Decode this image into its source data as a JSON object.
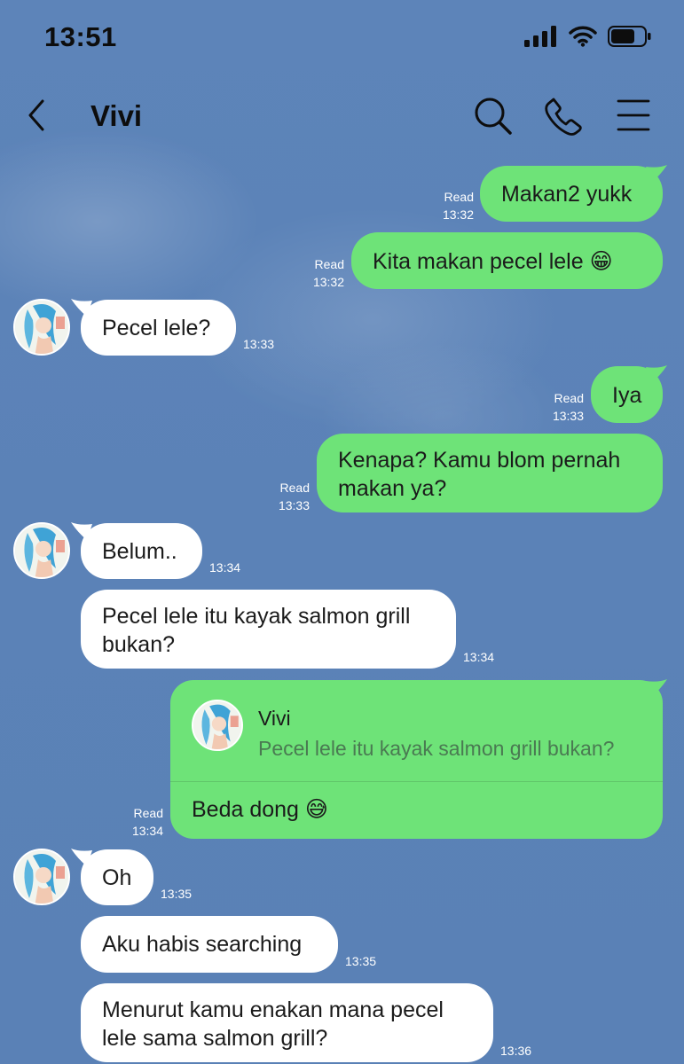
{
  "status_bar": {
    "time": "13:51"
  },
  "header": {
    "title": "Vivi",
    "icons": [
      "back-icon",
      "search-icon",
      "call-icon",
      "menu-icon"
    ]
  },
  "colors": {
    "outgoing": "#6ee378",
    "incoming": "#ffffff",
    "background": "#5a82b8"
  },
  "messages": [
    {
      "dir": "out",
      "text": "Makan2 yukk",
      "status": "Read",
      "time": "13:32"
    },
    {
      "dir": "out",
      "text": "Kita makan pecel lele 😁",
      "status": "Read",
      "time": "13:32"
    },
    {
      "dir": "in",
      "text": "Pecel lele?",
      "time": "13:33"
    },
    {
      "dir": "out",
      "text": "Iya",
      "status": "Read",
      "time": "13:33"
    },
    {
      "dir": "out",
      "lines": [
        "Kenapa? Kamu blom pernah",
        "makan ya?"
      ],
      "status": "Read",
      "time": "13:33"
    },
    {
      "dir": "in",
      "text": "Belum..",
      "time": "13:34"
    },
    {
      "dir": "in",
      "lines": [
        "Pecel lele itu kayak salmon grill",
        "bukan?"
      ],
      "time": "13:34"
    },
    {
      "dir": "out",
      "reply_to": {
        "name": "Vivi",
        "text": "Pecel lele itu kayak salmon grill bukan?"
      },
      "text": "Beda dong 😅",
      "status": "Read",
      "time": "13:34"
    },
    {
      "dir": "in",
      "text": "Oh",
      "time": "13:35"
    },
    {
      "dir": "in",
      "text": "Aku habis searching",
      "time": "13:35"
    },
    {
      "dir": "in",
      "lines": [
        "Menurut kamu enakan mana pecel",
        "lele sama salmon grill?"
      ],
      "time": "13:36"
    }
  ]
}
